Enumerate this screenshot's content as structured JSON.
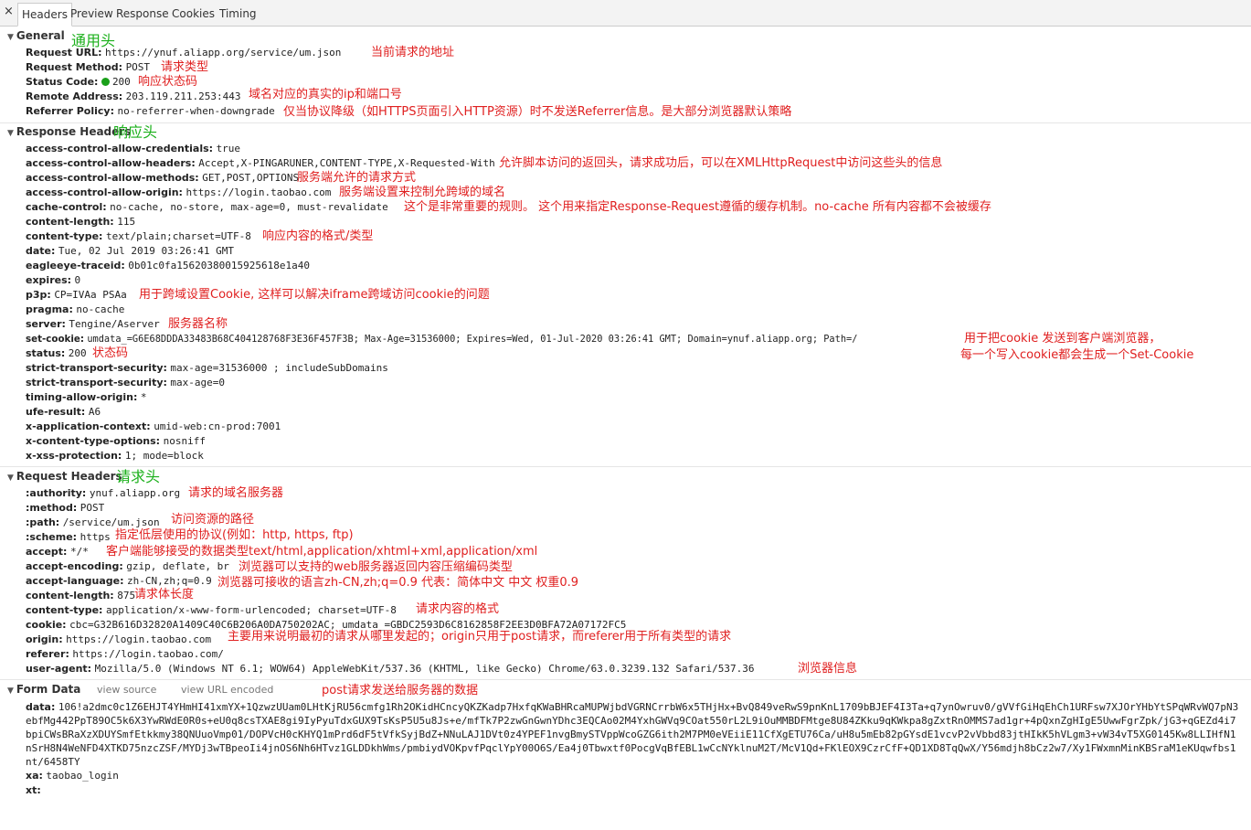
{
  "tabs": {
    "close": "×",
    "items": [
      "Headers",
      "Preview",
      "Response",
      "Cookies",
      "Timing"
    ],
    "active": 0
  },
  "general": {
    "title": "General",
    "note": "通用头",
    "rows": [
      {
        "k": "Request URL:",
        "v": "https://ynuf.aliapp.org/service/um.json",
        "a": "当前请求的地址"
      },
      {
        "k": "Request Method:",
        "v": "POST",
        "a": "请求类型"
      },
      {
        "k": "Status Code:",
        "v": "200",
        "a": "响应状态码"
      },
      {
        "k": "Remote Address:",
        "v": "203.119.211.253:443",
        "a": "域名对应的真实的ip和端口号"
      },
      {
        "k": "Referrer Policy:",
        "v": "no-referrer-when-downgrade",
        "a": "仅当协议降级（如HTTPS页面引入HTTP资源）时不发送Referrer信息。是大部分浏览器默认策略"
      }
    ]
  },
  "response": {
    "title": "Response Headers",
    "note": "响应头",
    "rows": [
      {
        "k": "access-control-allow-credentials:",
        "v": "true",
        "a": ""
      },
      {
        "k": "access-control-allow-headers:",
        "v": "Accept,X-PINGARUNER,CONTENT-TYPE,X-Requested-With",
        "a": "允许脚本访问的返回头，请求成功后，可以在XMLHttpRequest中访问这些头的信息"
      },
      {
        "k": "access-control-allow-methods:",
        "v": "GET,POST,OPTIONS",
        "a": "服务端允许的请求方式"
      },
      {
        "k": "access-control-allow-origin:",
        "v": "https://login.taobao.com",
        "a": "服务端设置来控制允跨域的域名"
      },
      {
        "k": "cache-control:",
        "v": "no-cache, no-store, max-age=0, must-revalidate",
        "a": "这个是非常重要的规则。 这个用来指定Response-Request遵循的缓存机制。no-cache 所有内容都不会被缓存"
      },
      {
        "k": "content-length:",
        "v": "115",
        "a": ""
      },
      {
        "k": "content-type:",
        "v": "text/plain;charset=UTF-8",
        "a": "响应内容的格式/类型"
      },
      {
        "k": "date:",
        "v": "Tue, 02 Jul 2019 03:26:41 GMT",
        "a": ""
      },
      {
        "k": "eagleeye-traceid:",
        "v": "0b01c0fa15620380015925618e1a40",
        "a": ""
      },
      {
        "k": "expires:",
        "v": "0",
        "a": ""
      },
      {
        "k": "p3p:",
        "v": "CP=IVAa PSAa",
        "a": "用于跨域设置Cookie, 这样可以解决iframe跨域访问cookie的问题"
      },
      {
        "k": "pragma:",
        "v": "no-cache",
        "a": ""
      },
      {
        "k": "server:",
        "v": "Tengine/Aserver",
        "a": "服务器名称"
      },
      {
        "k": "set-cookie:",
        "v": "umdata_=G6E68DDDA33483B68C404128768F3E36F457F3B; Max-Age=31536000; Expires=Wed, 01-Jul-2020 03:26:41 GMT; Domain=ynuf.aliapp.org; Path=/",
        "a": "用于把cookie 发送到客户端浏览器，"
      },
      {
        "k": "status:",
        "v": "200",
        "a": "状态码"
      },
      {
        "k": "strict-transport-security:",
        "v": "max-age=31536000 ; includeSubDomains",
        "a": ""
      },
      {
        "k": "strict-transport-security:",
        "v": "max-age=0",
        "a": ""
      },
      {
        "k": "timing-allow-origin:",
        "v": "*",
        "a": ""
      },
      {
        "k": "ufe-result:",
        "v": "A6",
        "a": ""
      },
      {
        "k": "x-application-context:",
        "v": "umid-web:cn-prod:7001",
        "a": ""
      },
      {
        "k": "x-content-type-options:",
        "v": "nosniff",
        "a": ""
      },
      {
        "k": "x-xss-protection:",
        "v": "1; mode=block",
        "a": ""
      }
    ],
    "setcookie_note2": "每一个写入cookie都会生成一个Set-Cookie"
  },
  "request": {
    "title": "Request Headers",
    "note": "请求头",
    "rows": [
      {
        "k": ":authority:",
        "v": "ynuf.aliapp.org",
        "a": "请求的域名服务器"
      },
      {
        "k": ":method:",
        "v": "POST",
        "a": ""
      },
      {
        "k": ":path:",
        "v": "/service/um.json",
        "a": "访问资源的路径"
      },
      {
        "k": ":scheme:",
        "v": "https",
        "a": "指定低层使用的协议(例如：http, https, ftp)"
      },
      {
        "k": "accept:",
        "v": "*/*",
        "a": "客户端能够接受的数据类型text/html,application/xhtml+xml,application/xml"
      },
      {
        "k": "accept-encoding:",
        "v": "gzip, deflate, br",
        "a": "浏览器可以支持的web服务器返回内容压缩编码类型"
      },
      {
        "k": "accept-language:",
        "v": "zh-CN,zh;q=0.9",
        "a": "浏览器可接收的语言zh-CN,zh;q=0.9 代表：简体中文 中文 权重0.9"
      },
      {
        "k": "content-length:",
        "v": "875",
        "a": "请求体长度"
      },
      {
        "k": "content-type:",
        "v": "application/x-www-form-urlencoded; charset=UTF-8",
        "a": "请求内容的格式"
      },
      {
        "k": "cookie:",
        "v": "cbc=G32B616D32820A1409C40C6B206A0DA750202AC; umdata_=GBDC2593D6C8162858F2EE3D0BFA72A07172FC5",
        "a": ""
      },
      {
        "k": "origin:",
        "v": "https://login.taobao.com",
        "a": "主要用来说明最初的请求从哪里发起的；origin只用于post请求，而referer用于所有类型的请求"
      },
      {
        "k": "referer:",
        "v": "https://login.taobao.com/",
        "a": ""
      },
      {
        "k": "user-agent:",
        "v": "Mozilla/5.0 (Windows NT 6.1; WOW64) AppleWebKit/537.36 (KHTML, like Gecko) Chrome/63.0.3239.132 Safari/537.36",
        "a": "浏览器信息"
      }
    ]
  },
  "form": {
    "title": "Form Data",
    "view_source": "view source",
    "view_url": "view URL encoded",
    "note": "post请求发送给服务器的数据",
    "data_key": "data:",
    "data_val": "106!a2dmc0c1Z6EHJT4YHmHI41xmYX+1QzwzUUam0LHtKjRU56cmfg1Rh2OKidHCncyQKZKadp7HxfqKWaBHRcaMUPWjbdVGRNCrrbW6x5THjHx+BvQ849veRwS9pnKnL1709bBJEF4I3Ta+q7ynOwruv0/gVVfGiHqEhCh1URFsw7XJOrYHbYtSPqWRvWQ7pN3ebfMg442PpT89OC5k6X3YwRWdE0R0s+eU0q8csTXAE8gi9IyPyuTdxGUX9TsKsP5U5u8Js+e/mfTk7P2zwGnGwnYDhc3EQCAo02M4YxhGWVq9COat550rL2L9iOuMMBDFMtge8U84ZKku9qKWkpa8gZxtRnOMMS7ad1gr+4pQxnZgHIgE5UwwFgrZpk/jG3+qGEZd4i7bpiCWsBRaXzXDUYSmfEtkkmy38QNUuoVmp01/DOPVcH0cKHYQ1mPrd6dF5tVfkSyjBdZ+NNuLAJ1DVt0z4YPEF1nvgBmySTVppWcoGZG6ith2M7PM0eVEiiE11CfXgETU76Ca/uH8u5mEb82pGYsdE1vcvP2vVbbd83jtHIkK5hVLgm3+vW34vT5XG0145Kw8LLIHfN1nSrH8N4WeNFD4XTKD75nzcZSF/MYDj3wTBpeoIi4jnOS6Nh6HTvz1GLDDkhWms/pmbiydVOKpvfPqclYpY00O6S/Ea4j0Tbwxtf0PocgVqBfEBL1wCcNYklnuM2T/McV1Qd+FKlEOX9CzrCfF+QD1XD8TqQwX/Y56mdjh8bCz2w7/Xy1FWxmnMinKBSraM1eKUqwfbs1nt/6458TY",
    "rows": [
      {
        "k": "xa:",
        "v": "taobao_login"
      },
      {
        "k": "xt:",
        "v": ""
      }
    ]
  }
}
